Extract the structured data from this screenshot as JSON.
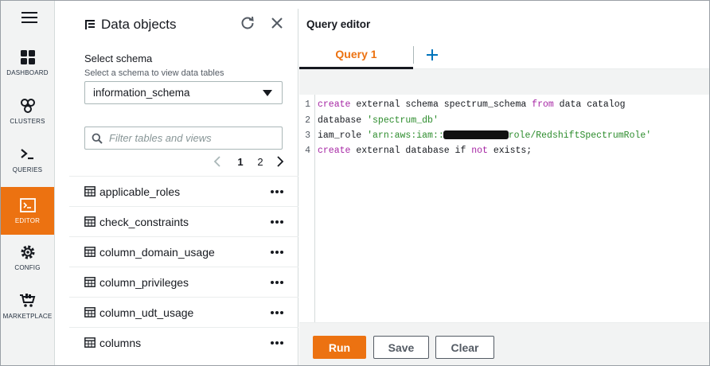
{
  "nav": {
    "items": [
      {
        "label": "DASHBOARD",
        "icon": "dashboard-icon"
      },
      {
        "label": "CLUSTERS",
        "icon": "clusters-icon"
      },
      {
        "label": "QUERIES",
        "icon": "queries-icon"
      },
      {
        "label": "EDITOR",
        "icon": "editor-icon",
        "active": true
      },
      {
        "label": "CONFIG",
        "icon": "config-icon"
      },
      {
        "label": "MARKETPLACE",
        "icon": "marketplace-icon"
      }
    ]
  },
  "data_objects": {
    "title": "Data objects",
    "schema_label": "Select schema",
    "schema_description": "Select a schema to view data tables",
    "schema_value": "information_schema",
    "filter_placeholder": "Filter tables and views",
    "pagination": {
      "current": "1",
      "next": "2"
    },
    "tables": [
      "applicable_roles",
      "check_constraints",
      "column_domain_usage",
      "column_privileges",
      "column_udt_usage",
      "columns"
    ]
  },
  "editor": {
    "title": "Query editor",
    "tabs": [
      {
        "label": "Query 1",
        "active": true
      }
    ],
    "line_numbers": [
      "1",
      "2",
      "3",
      "4"
    ],
    "code": {
      "l1_kw1": "create",
      "l1_t1": " external schema spectrum_schema ",
      "l1_kw2": "from",
      "l1_t2": " data catalog",
      "l2_t1": "database ",
      "l2_str": "'spectrum_db'",
      "l3_t1": "iam_role ",
      "l3_str1": "'arn:aws:iam::",
      "l3_str2": "role/RedshiftSpectrumRole'",
      "l4_kw1": "create",
      "l4_t1": " external database if ",
      "l4_kw2": "not",
      "l4_t2": " exists;"
    },
    "buttons": {
      "run": "Run",
      "save": "Save",
      "clear": "Clear"
    }
  },
  "colors": {
    "accent": "#ec7211",
    "keyword": "#a626a4",
    "string": "#2c8c2c",
    "nav_bg": "#f2f3f3"
  }
}
